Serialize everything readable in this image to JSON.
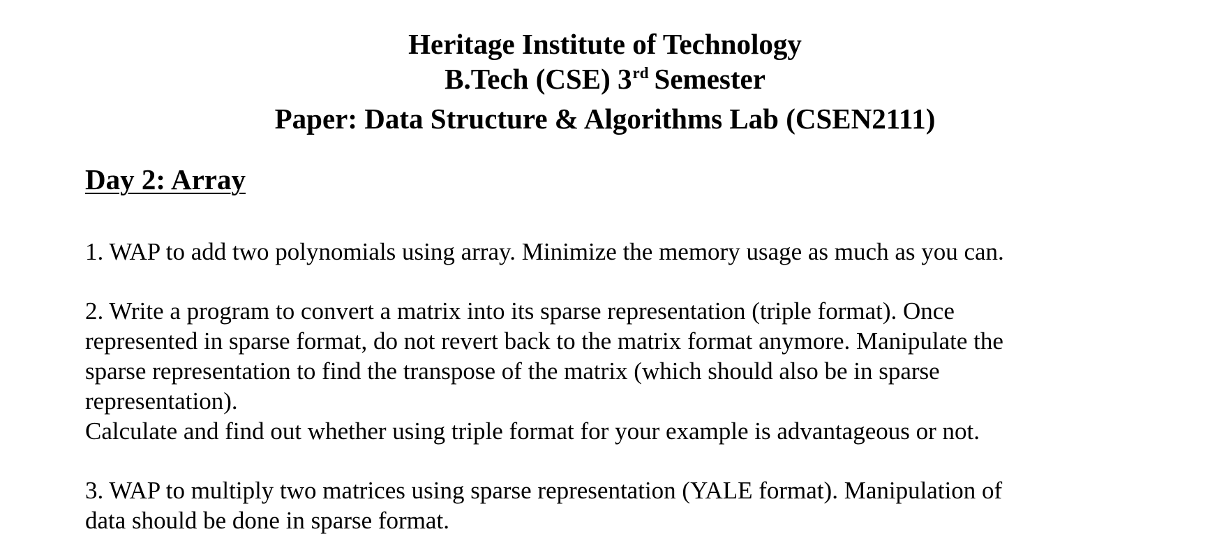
{
  "header": {
    "institute": "Heritage Institute of Technology",
    "course_prefix": "B.Tech (CSE) 3",
    "course_sup": "rd",
    "course_suffix": "Semester",
    "paper": "Paper: Data Structure & Algorithms Lab (CSEN2111)"
  },
  "section": {
    "title": "Day 2: Array"
  },
  "problems": [
    {
      "lines": [
        "1. WAP to add two polynomials using array. Minimize the memory usage as much as you can."
      ]
    },
    {
      "lines": [
        "2. Write a program to convert a matrix into its sparse representation (triple format). Once",
        "represented in sparse format, do not revert back to the matrix format anymore. Manipulate the",
        "sparse representation to find the transpose of the matrix (which should also be in sparse",
        "representation).",
        "Calculate and find out whether using triple format for your example is advantageous or not."
      ]
    },
    {
      "lines": [
        "3. WAP to multiply two matrices using sparse representation (YALE format). Manipulation of",
        "data should be done in sparse format."
      ]
    }
  ]
}
